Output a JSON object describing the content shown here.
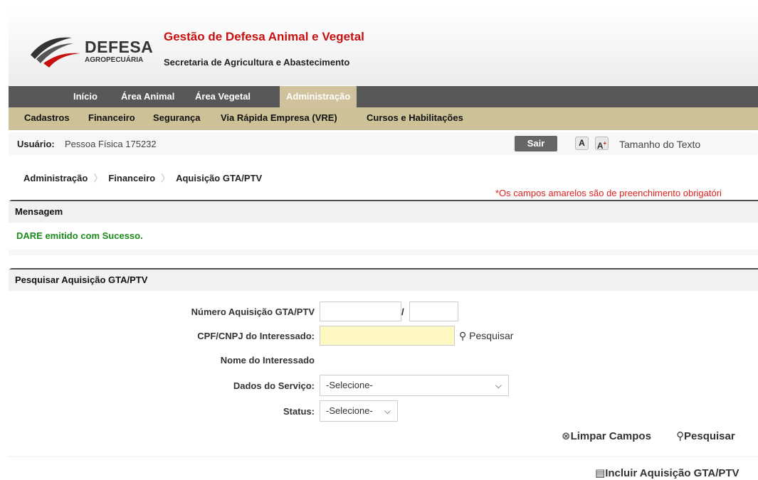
{
  "header": {
    "logo_text": "DEFESA",
    "logo_sub": "AGROPECUÁRIA",
    "title": "Gestão de Defesa Animal e Vegetal",
    "subtitle": "Secretaria de Agricultura e Abastecimento"
  },
  "nav": {
    "main": [
      {
        "label": "Início"
      },
      {
        "label": "Área Animal"
      },
      {
        "label": "Área Vegetal"
      },
      {
        "label": "Administração",
        "active": true
      }
    ],
    "sub": [
      {
        "label": "Cadastros"
      },
      {
        "label": "Financeiro"
      },
      {
        "label": "Segurança"
      },
      {
        "label": "Via Rápida Empresa (VRE)"
      },
      {
        "label": "Cursos e Habilitações"
      }
    ]
  },
  "userbar": {
    "user_label": "Usuário:",
    "user_value": "Pessoa Física 175232",
    "logout_label": "Sair",
    "font_small": "A",
    "font_large": "A",
    "font_label": "Tamanho do Texto"
  },
  "breadcrumb": [
    "Administração",
    "Financeiro",
    "Aquisição GTA/PTV"
  ],
  "required_note": "*Os campos amarelos são de preenchimento obrigatóri",
  "message_panel": {
    "title": "Mensagem",
    "text": "DARE emitido com Sucesso."
  },
  "search_panel": {
    "title": "Pesquisar Aquisição GTA/PTV",
    "fields": {
      "numero_label": "Número Aquisição GTA/PTV",
      "numero_value": "",
      "numero_year_value": "",
      "separator": "/",
      "cpf_label": "CPF/CNPJ do Interessado:",
      "cpf_value": "",
      "cpf_search": "Pesquisar",
      "nome_label": "Nome do Interessado",
      "dados_label": "Dados do Serviço:",
      "dados_selected": "-Selecione-",
      "status_label": "Status:",
      "status_selected": "-Selecione-"
    },
    "actions": {
      "clear": "Limpar Campos",
      "search": "Pesquisar"
    }
  },
  "footer_action": "Incluir Aquisição GTA/PTV",
  "colors": {
    "brand_red": "#c81010",
    "nav_dark": "#585858",
    "nav_tan": "#cdc197",
    "success": "#1b8c1b",
    "required_bg": "#fff8c2"
  }
}
